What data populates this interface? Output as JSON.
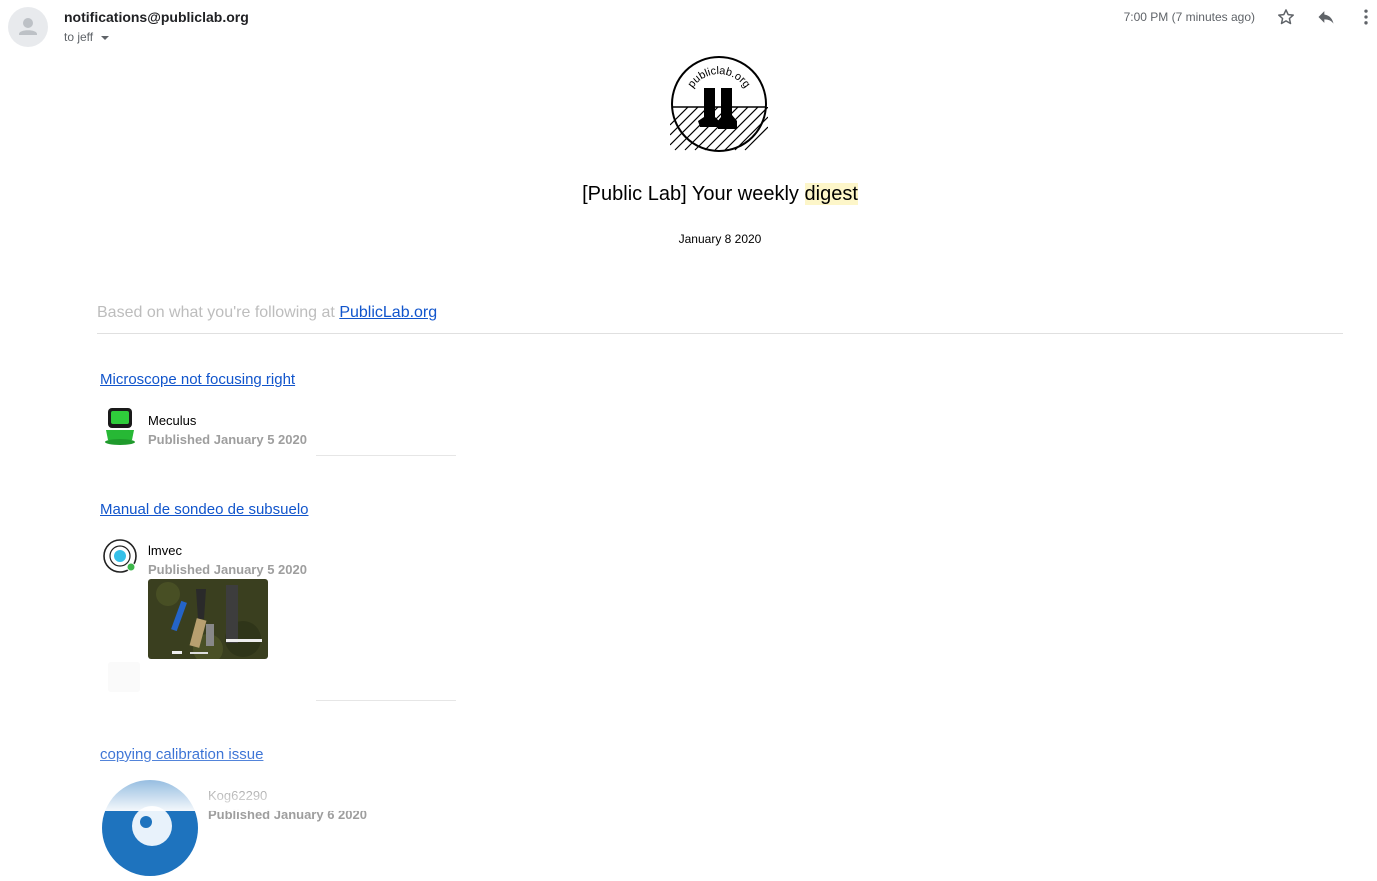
{
  "header": {
    "sender": "notifications@publiclab.org",
    "recipient": "to jeff",
    "time": "7:00 PM (7 minutes ago)"
  },
  "logo": {
    "text": "publiclab.org"
  },
  "email": {
    "title_prefix": "[Public Lab] Your weekly ",
    "title_highlight": "digest",
    "date": "January 8 2020",
    "intro": "Based on what you're following at ",
    "intro_link": "PublicLab.org"
  },
  "posts": [
    {
      "title": "Microscope not focusing right",
      "author": "Meculus",
      "published": "Published January 5 2020"
    },
    {
      "title": "Manual de sondeo de subsuelo",
      "author": "lmvec",
      "published": "Published January 5 2020"
    },
    {
      "title": "copying calibration issue",
      "author": "Kog62290",
      "published": "Published January 6 2020"
    }
  ],
  "colors": {
    "link": "#1155cc",
    "highlight": "#fdf6c9",
    "muted": "#9e9e9e"
  }
}
